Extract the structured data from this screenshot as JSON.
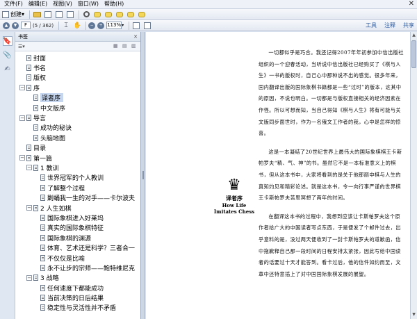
{
  "menubar": {
    "items": [
      "文件(F)",
      "编辑(E)",
      "视图(V)",
      "窗口(W)",
      "帮助(H)"
    ],
    "close_glyph": "✕"
  },
  "toolbar1": {
    "create_label": "创建",
    "dropdown_glyph": "▾"
  },
  "toolbar2": {
    "current_page": "F",
    "page_total": "(5 / 362)",
    "zoom": "113%",
    "links": [
      "工具",
      "注释",
      "共享"
    ]
  },
  "bookmarks": {
    "panel_title": "书签",
    "options_label": "☰▾",
    "close_glyph": "✕",
    "items": [
      {
        "label": "封面",
        "level": 0,
        "expander": ""
      },
      {
        "label": "书名",
        "level": 0,
        "expander": ""
      },
      {
        "label": "版权",
        "level": 0,
        "expander": ""
      },
      {
        "label": "序",
        "level": 0,
        "expander": "−"
      },
      {
        "label": "译者序",
        "level": 1,
        "expander": "",
        "selected": true
      },
      {
        "label": "中文版序",
        "level": 1,
        "expander": ""
      },
      {
        "label": "导言",
        "level": 0,
        "expander": "−"
      },
      {
        "label": "成功的秘诀",
        "level": 1,
        "expander": ""
      },
      {
        "label": "头脑地图",
        "level": 1,
        "expander": ""
      },
      {
        "label": "目录",
        "level": 0,
        "expander": ""
      },
      {
        "label": "第一篇",
        "level": 0,
        "expander": "−"
      },
      {
        "label": "1 教训",
        "level": 1,
        "expander": "−"
      },
      {
        "label": "世界冠军的个人教训",
        "level": 2,
        "expander": ""
      },
      {
        "label": "了解整个过程",
        "level": 2,
        "expander": ""
      },
      {
        "label": "剿蛹我一生的对手——卡尔波夫",
        "level": 2,
        "expander": ""
      },
      {
        "label": "2 人生如棋",
        "level": 1,
        "expander": "−"
      },
      {
        "label": "国际象棋进入好莱坞",
        "level": 2,
        "expander": ""
      },
      {
        "label": "真实的国际象棋特征",
        "level": 2,
        "expander": ""
      },
      {
        "label": "国际象棋的渊源",
        "level": 2,
        "expander": ""
      },
      {
        "label": "体育、艺术还是科学？三者合一",
        "level": 2,
        "expander": ""
      },
      {
        "label": "不仅仅是比喻",
        "level": 2,
        "expander": ""
      },
      {
        "label": "永不让步的宗师——鲍特维尼克",
        "level": 2,
        "expander": ""
      },
      {
        "label": "3 战略",
        "level": 1,
        "expander": "−"
      },
      {
        "label": "任何速度下都能成功",
        "level": 2,
        "expander": ""
      },
      {
        "label": "当前决策的日后结果",
        "level": 2,
        "expander": ""
      },
      {
        "label": "稳定性与灵活性并不矛盾",
        "level": 2,
        "expander": ""
      }
    ]
  },
  "document": {
    "chapter_glyph": "♛",
    "chapter_title": "译者序",
    "chapter_sub": [
      "How Life",
      "Imitates Chess"
    ],
    "paragraphs": [
      "一切都似乎是巧合。我还记得2007年年初参加中信出版社组织的一个迎春活动，当听说中信出版社已经购买了《棋与人生》一书的版权时，自己心中那种说不出的感觉。很多年来，国内翻译出版的国际象棋书籍都是一些“过时”的版本，这其中的原因，不说也明白。一切都是与版权直接相关的经济因素在作怪。所以可想而知，当自己得知《棋与人生》将有可能与关文版同步面世时，作为一名俄文工作者的我，心中是怎样的惊喜。",
      "这是一本凝结了20世纪世界上最伟大的国际象棋棋王卡斯帕罗夫“精、气、神”的书。虽然它不是一本标准意义上的棋书，但从这本书中，大家将看到的是关于他那丽中棋与人生的真知灼见和精彩论述。就是这本书，令一向行事严谨的世界棋王卡斯帕罗夫苦思冥想了两年的时间。",
      "在翻译这本书的过程中，我想到应该让卡斯帕罗夫这个原作者给广大的中国读者写点东西，于是便发了个邮件过去，出乎意料的是，没过两天便收到了一封卡斯帕罗夫的道歉函，信中拖歉释自己那一段时间的日程安排太紧张，因此写给中国读者的话要过十天才能答到。看卡过后，他的信件如约而至，文章中还特意插上了对中国国际象棋发展的展望。"
    ]
  }
}
